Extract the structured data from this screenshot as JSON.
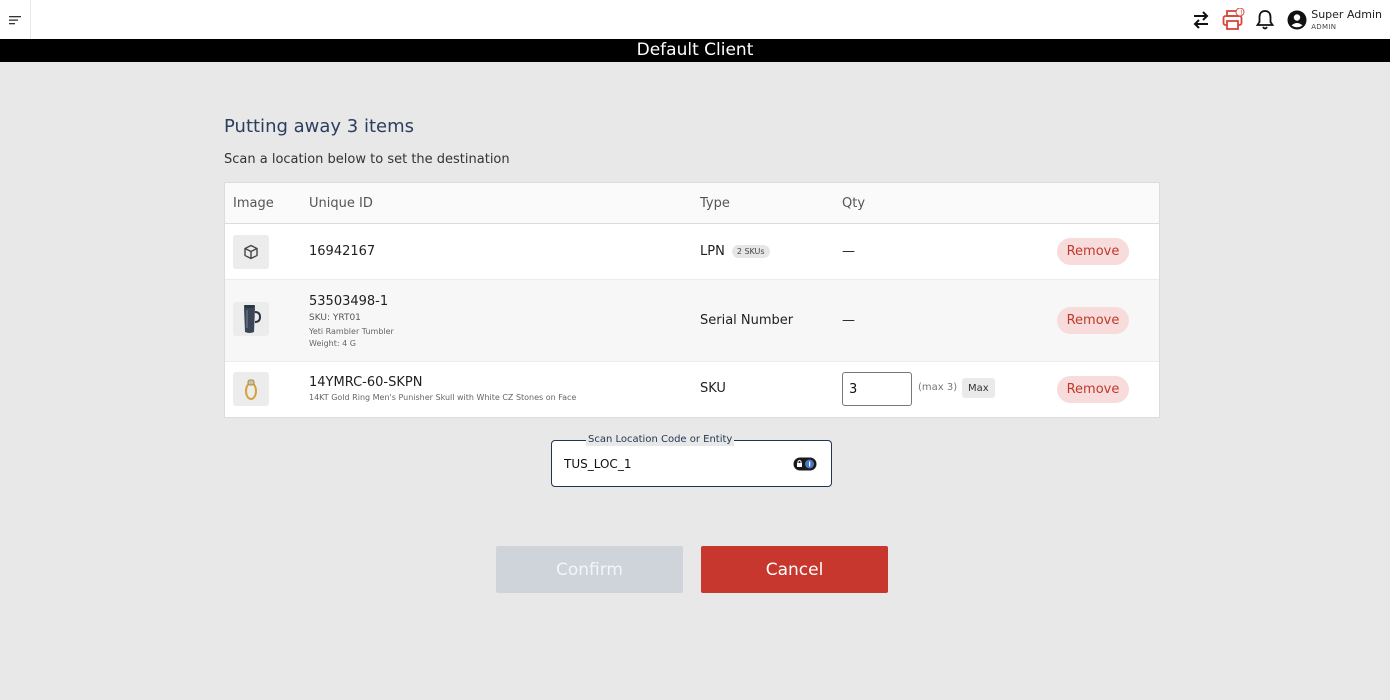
{
  "header": {
    "user_name": "Super Admin",
    "user_role": "ADMIN",
    "printer_alert_count": "!",
    "icons": [
      "menu-icon",
      "swap-arrows-icon",
      "printer-icon",
      "bell-icon",
      "account-circle-icon"
    ]
  },
  "client_bar": {
    "title": "Default Client"
  },
  "page": {
    "title": "Putting away 3 items",
    "subtitle": "Scan a location below to set the destination"
  },
  "table": {
    "columns": [
      "Image",
      "Unique ID",
      "Type",
      "Qty"
    ],
    "rows": [
      {
        "unique_id": "16942167",
        "type": "LPN",
        "type_badge": "2 SKUs",
        "qty": "—",
        "action": "Remove",
        "image": "box-icon"
      },
      {
        "unique_id": "53503498-1",
        "sku": "SKU: YRT01",
        "description": "Yeti Rambler Tumbler",
        "weight": "Weight: 4 G",
        "type": "Serial Number",
        "qty": "—",
        "action": "Remove",
        "image": "tumbler-image"
      },
      {
        "unique_id": "14YMRC-60-SKPN",
        "description": "14KT Gold Ring Men's Punisher Skull with White CZ Stones on Face",
        "type": "SKU",
        "qty_value": "3",
        "qty_max_note": "(max 3)",
        "max_label": "Max",
        "action": "Remove",
        "image": "gold-ring-image"
      }
    ]
  },
  "scan": {
    "label": "Scan Location Code or Entity",
    "value": "TUS_LOC_1"
  },
  "actions": {
    "confirm": "Confirm",
    "cancel": "Cancel"
  },
  "colors": {
    "accent_red": "#c8372d",
    "remove_bg": "#f8dcdc",
    "title_navy": "#2c3e5c",
    "page_bg": "#e8e8e8"
  }
}
